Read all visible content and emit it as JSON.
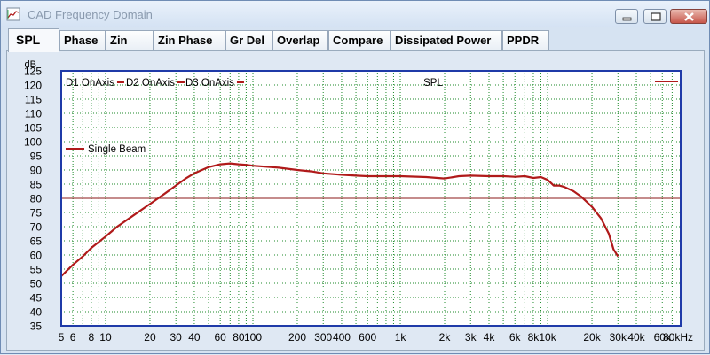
{
  "window": {
    "title": "CAD Frequency Domain",
    "buttons": [
      "minimize",
      "restore",
      "close"
    ]
  },
  "tabs": [
    {
      "label": "SPL",
      "active": true
    },
    {
      "label": "Phase",
      "active": false
    },
    {
      "label": "Zin",
      "active": false
    },
    {
      "label": "Zin Phase",
      "active": false
    },
    {
      "label": "Gr Del",
      "active": false
    },
    {
      "label": "Overlap",
      "active": false
    },
    {
      "label": "Compare",
      "active": false
    },
    {
      "label": "Dissipated Power",
      "active": false
    },
    {
      "label": "PPDR",
      "active": false
    }
  ],
  "chart_data": {
    "type": "line",
    "title": "SPL",
    "ylabel": "dB",
    "xlabel": "",
    "x_scale": "log",
    "xlim": [
      5,
      80000
    ],
    "ylim": [
      35,
      125
    ],
    "grid": true,
    "y_ticks": [
      35,
      40,
      45,
      50,
      55,
      60,
      65,
      70,
      75,
      80,
      85,
      90,
      95,
      100,
      105,
      110,
      115,
      120,
      125
    ],
    "x_tick_labels": [
      {
        "value": 5,
        "label": "5"
      },
      {
        "value": 6,
        "label": "6"
      },
      {
        "value": 8,
        "label": "8"
      },
      {
        "value": 10,
        "label": "10"
      },
      {
        "value": 20,
        "label": "20"
      },
      {
        "value": 30,
        "label": "30"
      },
      {
        "value": 40,
        "label": "40"
      },
      {
        "value": 60,
        "label": "60"
      },
      {
        "value": 80,
        "label": "80"
      },
      {
        "value": 100,
        "label": "100"
      },
      {
        "value": 200,
        "label": "200"
      },
      {
        "value": 300,
        "label": "300"
      },
      {
        "value": 400,
        "label": "400"
      },
      {
        "value": 600,
        "label": "600"
      },
      {
        "value": 1000,
        "label": "1k"
      },
      {
        "value": 2000,
        "label": "2k"
      },
      {
        "value": 3000,
        "label": "3k"
      },
      {
        "value": 4000,
        "label": "4k"
      },
      {
        "value": 6000,
        "label": "6k"
      },
      {
        "value": 8000,
        "label": "8k"
      },
      {
        "value": 10000,
        "label": "10k"
      },
      {
        "value": 20000,
        "label": "20k"
      },
      {
        "value": 30000,
        "label": "30k"
      },
      {
        "value": 40000,
        "label": "40k"
      },
      {
        "value": 60000,
        "label": "60k"
      },
      {
        "value": 80000,
        "label": "80kHz"
      }
    ],
    "reference_line": {
      "y": 80
    },
    "legend_top": [
      "D1 OnAxis",
      "D2 OnAxis",
      "D3 OnAxis"
    ],
    "legend_side": "Single Beam",
    "series": [
      {
        "name": "Single Beam",
        "color": "#b01a1a",
        "points": [
          [
            5,
            52.5
          ],
          [
            6,
            56.5
          ],
          [
            7,
            59.5
          ],
          [
            8,
            62.5
          ],
          [
            10,
            66.5
          ],
          [
            12,
            70
          ],
          [
            15,
            73.5
          ],
          [
            20,
            78
          ],
          [
            25,
            81.5
          ],
          [
            30,
            84.5
          ],
          [
            35,
            87
          ],
          [
            40,
            88.8
          ],
          [
            50,
            91
          ],
          [
            60,
            92
          ],
          [
            70,
            92.3
          ],
          [
            80,
            92
          ],
          [
            90,
            91.8
          ],
          [
            100,
            91.5
          ],
          [
            120,
            91.2
          ],
          [
            150,
            90.8
          ],
          [
            200,
            90
          ],
          [
            250,
            89.5
          ],
          [
            300,
            88.8
          ],
          [
            400,
            88.3
          ],
          [
            500,
            88
          ],
          [
            600,
            87.8
          ],
          [
            800,
            87.8
          ],
          [
            1000,
            87.8
          ],
          [
            1500,
            87.5
          ],
          [
            2000,
            87
          ],
          [
            2500,
            87.8
          ],
          [
            3000,
            88
          ],
          [
            4000,
            87.8
          ],
          [
            5000,
            87.8
          ],
          [
            6000,
            87.6
          ],
          [
            7000,
            87.8
          ],
          [
            8000,
            87.2
          ],
          [
            9000,
            87.5
          ],
          [
            10000,
            86.5
          ],
          [
            11000,
            84.5
          ],
          [
            12000,
            84.5
          ],
          [
            13000,
            84
          ],
          [
            15000,
            82.5
          ],
          [
            17000,
            80.5
          ],
          [
            20000,
            77
          ],
          [
            23000,
            73
          ],
          [
            26000,
            67.5
          ],
          [
            28000,
            62
          ],
          [
            30000,
            59.5
          ]
        ]
      }
    ]
  }
}
